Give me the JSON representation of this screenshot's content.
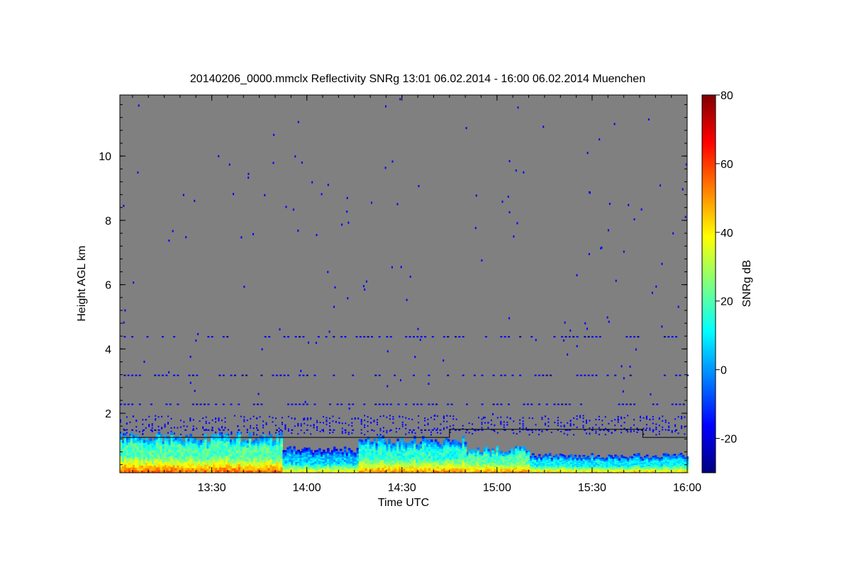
{
  "chart_data": {
    "type": "heatmap",
    "title": "20140206_0000.mmclx Reflectivity SNRg   13:01 06.02.2014 - 16:00 06.02.2014 Muenchen",
    "xlabel": "Time UTC",
    "ylabel": "Height AGL km",
    "colorbar_label": "SNRg dB",
    "xlim": [
      "13:01",
      "16:00"
    ],
    "ylim": [
      0.15,
      11.9
    ],
    "x_ticks": [
      "13:30",
      "14:00",
      "14:30",
      "15:00",
      "15:30",
      "16:00"
    ],
    "y_ticks": [
      2,
      4,
      6,
      8,
      10
    ],
    "colorbar_range": [
      -30,
      80
    ],
    "colorbar_ticks": [
      -20,
      0,
      20,
      40,
      60,
      80
    ],
    "colormap": [
      "#00007f",
      "#0000ff",
      "#007fff",
      "#00ffff",
      "#7fff7f",
      "#ffff00",
      "#ff7f00",
      "#ff0000",
      "#7f0000"
    ],
    "no_signal_color": "#808080",
    "cloud_layer": {
      "description_segments": [
        {
          "t_start": "13:01",
          "t_end": "13:52",
          "top_km": 1.3,
          "snr_core_db": 20,
          "snr_surface_db": 55
        },
        {
          "t_start": "13:52",
          "t_end": "14:16",
          "top_km": 0.9,
          "snr_core_db": 5,
          "snr_surface_db": 40
        },
        {
          "t_start": "14:16",
          "t_end": "14:50",
          "top_km": 1.2,
          "snr_core_db": 15,
          "snr_surface_db": 50
        },
        {
          "t_start": "14:50",
          "t_end": "15:10",
          "top_km": 0.9,
          "snr_core_db": 20,
          "snr_surface_db": 50
        },
        {
          "t_start": "15:10",
          "t_end": "16:00",
          "top_km": 0.7,
          "snr_core_db": 10,
          "snr_surface_db": 45
        }
      ]
    },
    "sparse_echo_rows_km": [
      4.4,
      3.2,
      2.3,
      1.5
    ],
    "boundary_line_km": [
      {
        "t_start": "13:01",
        "t_end": "14:45",
        "height_km": 1.25
      },
      {
        "t_start": "14:45",
        "t_end": "15:46",
        "height_km": 1.5
      },
      {
        "t_start": "15:46",
        "t_end": "16:00",
        "height_km": 1.25
      }
    ],
    "grid": false
  }
}
